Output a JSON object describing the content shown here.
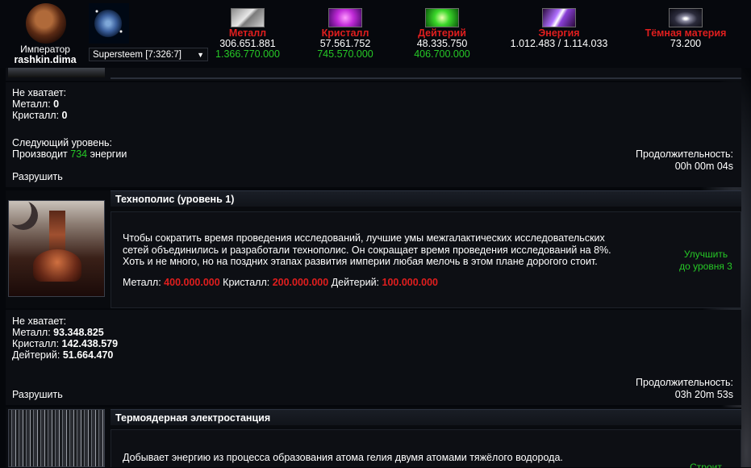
{
  "header": {
    "rank": "Император",
    "username": "rashkin.dima",
    "planet_select": "Supersteem [7:326:7]",
    "resources": [
      {
        "name": "Металл",
        "value": "306.651.881",
        "production": "1.366.770.000",
        "color": "#e01e1e",
        "icon": "metal-icon"
      },
      {
        "name": "Кристалл",
        "value": "57.561.752",
        "production": "745.570.000",
        "color": "#e01e1e",
        "icon": "crystal-icon"
      },
      {
        "name": "Дейтерий",
        "value": "48.335.750",
        "production": "406.700.000",
        "color": "#e01e1e",
        "icon": "deuterium-icon"
      },
      {
        "name": "Энергия",
        "value": "1.012.483 / 1.114.033",
        "production": "",
        "color": "#e01e1e",
        "icon": "energy-icon"
      },
      {
        "name": "Тёмная материя",
        "value": "73.200",
        "production": "",
        "color": "#e01e1e",
        "icon": "dark-matter-icon"
      }
    ]
  },
  "building_prev": {
    "missing_label": "Не хватает:",
    "missing": [
      "Металл: ",
      "0",
      "Кристалл: ",
      "0"
    ],
    "next_level_label": "Следующий уровень:",
    "produces_prefix": "Производит ",
    "produces_value": "734",
    "produces_suffix": " энергии",
    "duration_label": "Продолжительность:",
    "duration_value": "00h 00m 04s",
    "destroy_label": "Разрушить"
  },
  "technopolis": {
    "title": "Технополис (уровень 1)",
    "description": [
      "Чтобы сократить время проведения исследований, лучшие умы межгалактических исследовательских",
      "сетей объединились и разработали технополис. Он сокращает время проведения исследований на 8%.",
      "Хоть и не много, но на поздних этапах развития империи любая мелочь в этом плане дорогого стоит."
    ],
    "cost_metal_label": "Металл: ",
    "cost_metal": "400.000.000",
    "cost_crystal_label": " Кристалл: ",
    "cost_crystal": "200.000.000",
    "cost_deut_label": " Дейтерий: ",
    "cost_deut": "100.000.000",
    "upgrade_line1": "Улучшить",
    "upgrade_line2": "до уровня 3",
    "missing_label": "Не хватает:",
    "missing_metal_label": "Металл: ",
    "missing_metal": "93.348.825",
    "missing_crystal_label": "Кристалл: ",
    "missing_crystal": "142.438.579",
    "missing_deut_label": "Дейтерий: ",
    "missing_deut": "51.664.470",
    "duration_label": "Продолжительность:",
    "duration_value": "03h 20m 53s",
    "destroy_label": "Разрушить"
  },
  "fusion": {
    "title": "Термоядерная электростанция",
    "description": "Добывает энергию из процесса образования атома гелия двумя атомами тяжёлого водорода.",
    "upgrade_partial": "Строит"
  }
}
